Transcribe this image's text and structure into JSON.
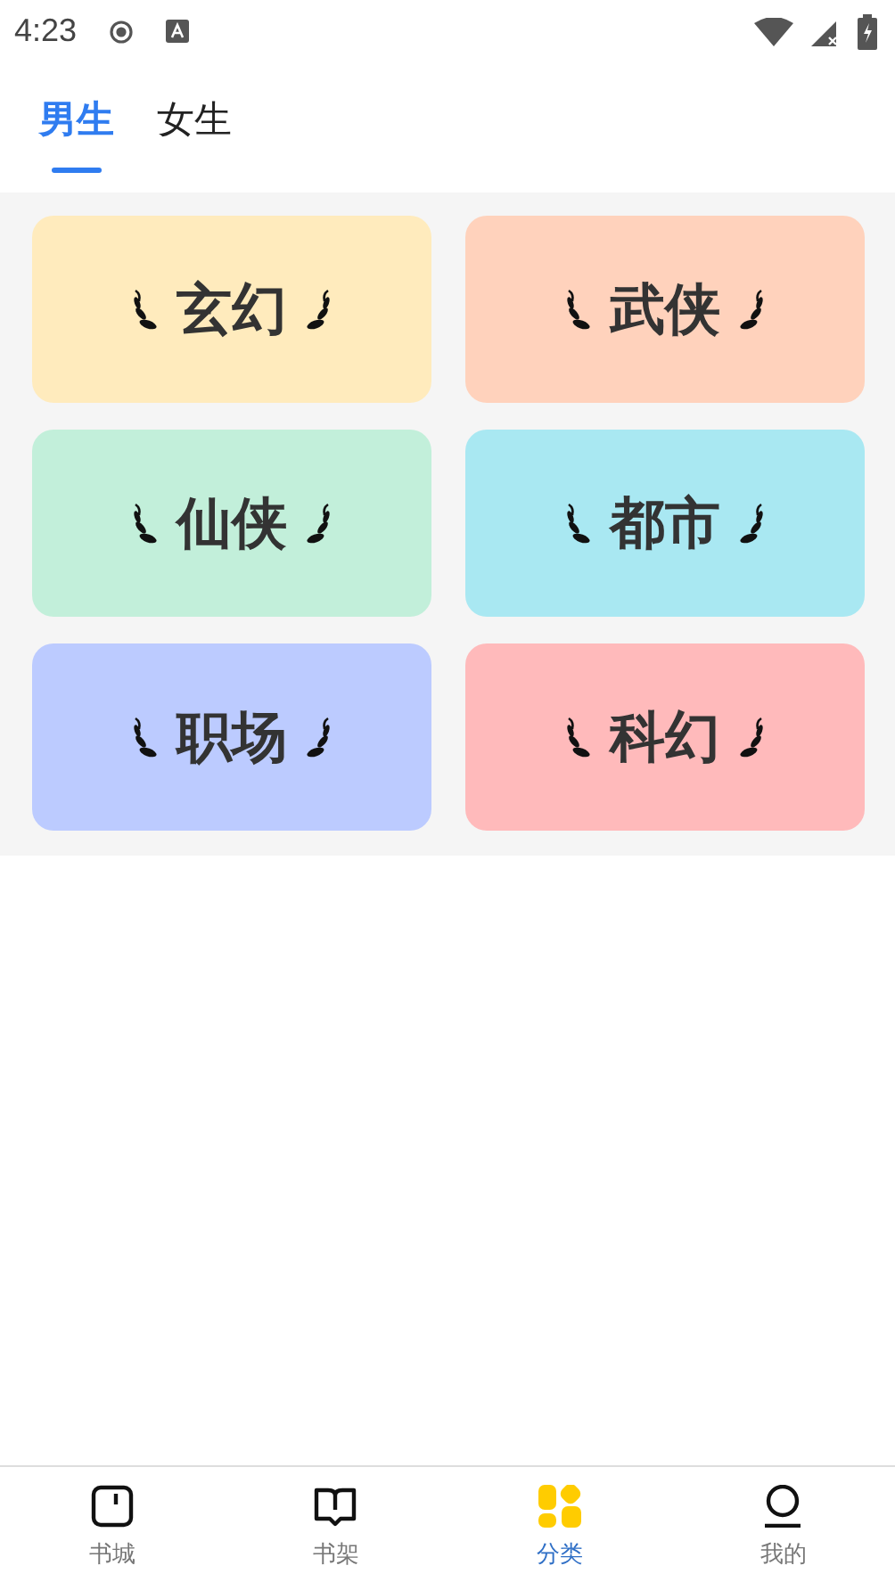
{
  "status_bar": {
    "time": "4:23"
  },
  "tabs": [
    {
      "label": "男生",
      "selected": true
    },
    {
      "label": "女生",
      "selected": false
    }
  ],
  "categories": [
    {
      "label": "玄幻",
      "color": "#ffebbd"
    },
    {
      "label": "武侠",
      "color": "#ffd2bc"
    },
    {
      "label": "仙侠",
      "color": "#c2efda"
    },
    {
      "label": "都市",
      "color": "#a9e8f2"
    },
    {
      "label": "职场",
      "color": "#bccbff"
    },
    {
      "label": "科幻",
      "color": "#ffbabb"
    }
  ],
  "nav": [
    {
      "label": "书城",
      "kind": "store",
      "selected": false
    },
    {
      "label": "书架",
      "kind": "shelf",
      "selected": false
    },
    {
      "label": "分类",
      "kind": "category",
      "selected": true
    },
    {
      "label": "我的",
      "kind": "profile",
      "selected": false
    }
  ]
}
